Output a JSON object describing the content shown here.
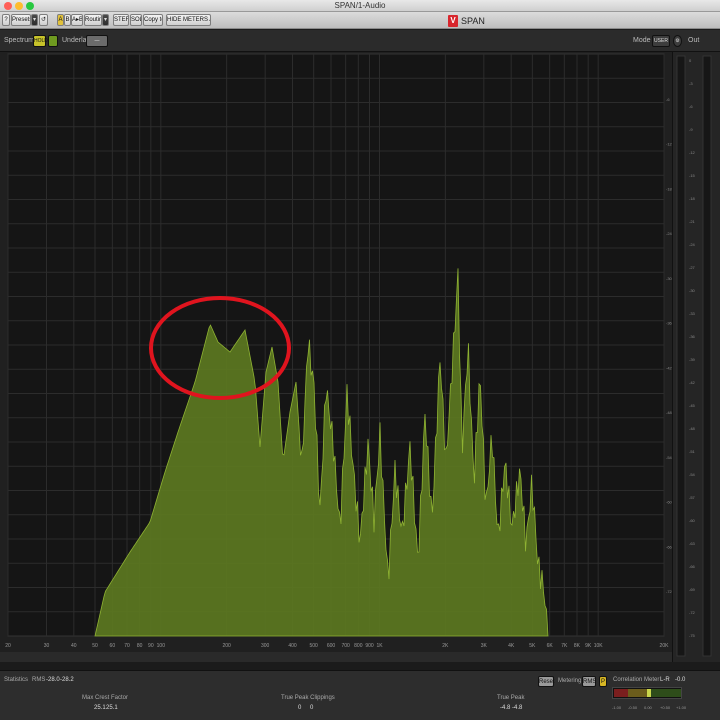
{
  "window": {
    "title": "SPAN/1-Audio"
  },
  "hostbar": {
    "help": "?",
    "presets": "Presets",
    "dropdown": "▾",
    "undo": "↺",
    "a_label": "A",
    "b_label": "B",
    "ab_label": "A▸B",
    "routing": "Routing",
    "stereo": "STEREO",
    "solo": "SOLO",
    "copy_to": "Copy to",
    "hide_meters": "HIDE METERS AND STATS"
  },
  "brand": {
    "logo": "V",
    "name": "SPAN"
  },
  "plugin_header": {
    "spectrum_label": "Spectrum",
    "hold_button": "HOLD",
    "underlay_label": "Underlay",
    "underlay_value": "—",
    "mode_label": "Mode",
    "mode_value": "USER",
    "out_label": "Out"
  },
  "db_scale": [
    "-6",
    "-12",
    "-18",
    "-24",
    "-30",
    "-36",
    "-42",
    "-48",
    "-54",
    "-60",
    "-66",
    "-72"
  ],
  "meter_scale": [
    "0",
    "-3",
    "-6",
    "-9",
    "-12",
    "-15",
    "-18",
    "-21",
    "-24",
    "-27",
    "-30",
    "-33",
    "-36",
    "-39",
    "-42",
    "-45",
    "-48",
    "-51",
    "-54",
    "-57",
    "-60",
    "-63",
    "-66",
    "-69",
    "-72",
    "-75"
  ],
  "freq_labels": [
    "20",
    "30",
    "40",
    "50",
    "60",
    "70",
    "80",
    "90",
    "100",
    "200",
    "300",
    "400",
    "500",
    "600",
    "700",
    "800",
    "900",
    "1K",
    "2K",
    "3K",
    "4K",
    "5K",
    "6K",
    "7K",
    "8K",
    "9K",
    "10K",
    "20K"
  ],
  "stats": {
    "title": "Statistics",
    "rms_label": "RMS",
    "rms_left": "-28.0",
    "rms_right": "-28.2",
    "max_crest_label": "Max Crest Factor",
    "max_crest_left": "25.1",
    "max_crest_right": "25.1",
    "clip_label": "True Peak Clippings",
    "clip_left": "0",
    "clip_right": "0",
    "true_peak_label": "True Peak",
    "true_peak_left": "-4.8",
    "true_peak_right": "-4.8",
    "reset": "Reset",
    "metering_label": "Metering",
    "metering_value": "RMS",
    "peak_button": "P",
    "correlation_label": "Correlation Meter",
    "corr_left": "L-R",
    "corr_value": "-0.0",
    "corr_scale": [
      "-1.00",
      "-0.50",
      "0.00",
      "+0.50",
      "+1.00"
    ]
  },
  "colors": {
    "spectrum_fill": "#5d7a20",
    "spectrum_line": "#8fb332",
    "highlight_circle": "#e0141e",
    "background": "#1b1b1b"
  },
  "annotation": {
    "shape": "circle",
    "color": "#e0141e"
  }
}
